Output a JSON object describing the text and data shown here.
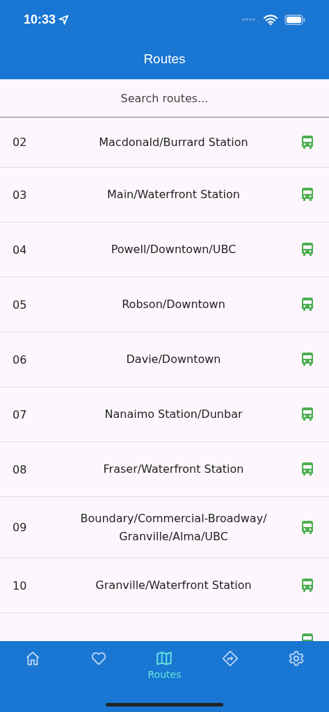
{
  "status_bar": {
    "time": "10:33"
  },
  "app_bar": {
    "title": "Routes"
  },
  "search": {
    "placeholder": "Search routes..."
  },
  "routes": [
    {
      "number": "02",
      "name": "Macdonald/Burrard Station"
    },
    {
      "number": "03",
      "name": "Main/Waterfront Station"
    },
    {
      "number": "04",
      "name": "Powell/Downtown/UBC"
    },
    {
      "number": "05",
      "name": "Robson/Downtown"
    },
    {
      "number": "06",
      "name": "Davie/Downtown"
    },
    {
      "number": "07",
      "name": "Nanaimo Station/Dunbar"
    },
    {
      "number": "08",
      "name": "Fraser/Waterfront Station"
    },
    {
      "number": "09",
      "name": "Boundary/Commercial-Broadway/ Granville/Alma/UBC"
    },
    {
      "number": "10",
      "name": "Granville/Waterfront Station"
    }
  ],
  "nav": [
    {
      "kind": "home",
      "selected": false
    },
    {
      "kind": "favorites",
      "selected": false
    },
    {
      "kind": "routes",
      "selected": true,
      "label": "Routes"
    },
    {
      "kind": "directions",
      "selected": false
    },
    {
      "kind": "settings",
      "selected": false
    }
  ]
}
